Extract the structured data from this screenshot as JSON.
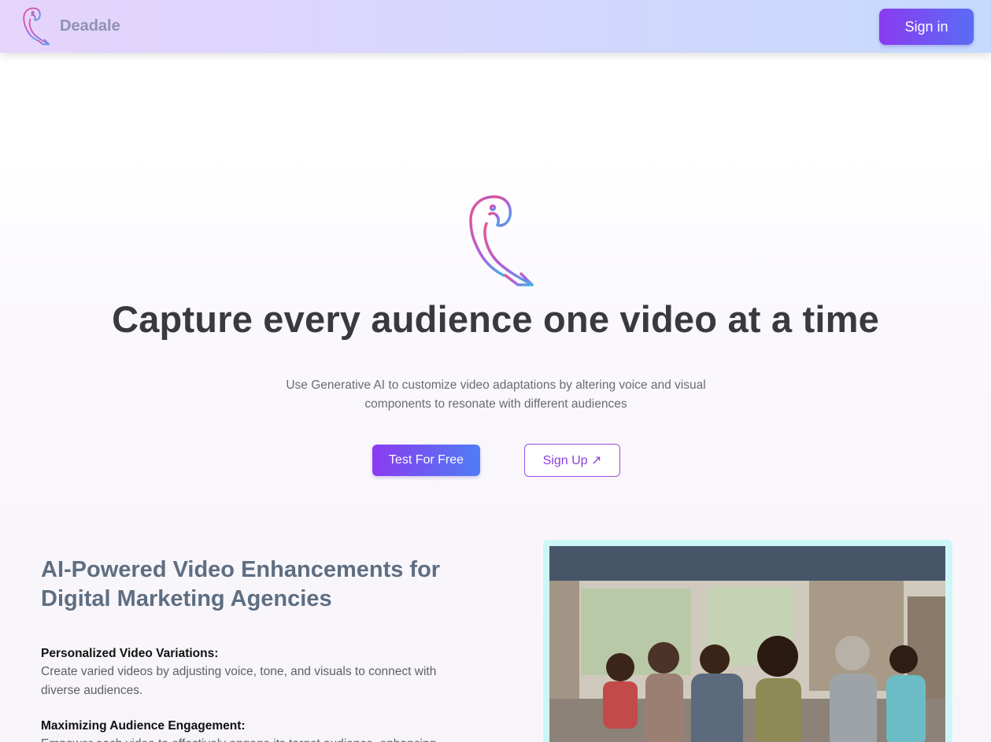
{
  "navbar": {
    "brand_name": "Deadale",
    "signin_label": "Sign in"
  },
  "hero": {
    "title": "Capture every audience one video at a time",
    "subtitle": "Use Generative AI to customize video adaptations by altering voice and visual components to resonate with different audiences",
    "primary_cta": "Test For Free",
    "secondary_cta": "Sign Up ↗"
  },
  "features": {
    "title": "AI-Powered Video Enhancements for Digital Marketing Agencies",
    "items": [
      {
        "title": "Personalized Video Variations:",
        "description": "Create varied videos by adjusting voice, tone, and visuals to connect with diverse audiences."
      },
      {
        "title": "Maximizing Audience Engagement:",
        "description": "Empower each video to effectively engage its target audience, enhancing..."
      }
    ]
  },
  "colors": {
    "brand_gradient_start": "#8b3bf0",
    "brand_gradient_end": "#4f7df5",
    "video_card_bg": "#cdf7f7",
    "video_header": "#475569"
  },
  "icons": {
    "brand_logo": "parrot-logo-icon",
    "hero_logo": "parrot-logo-icon"
  }
}
